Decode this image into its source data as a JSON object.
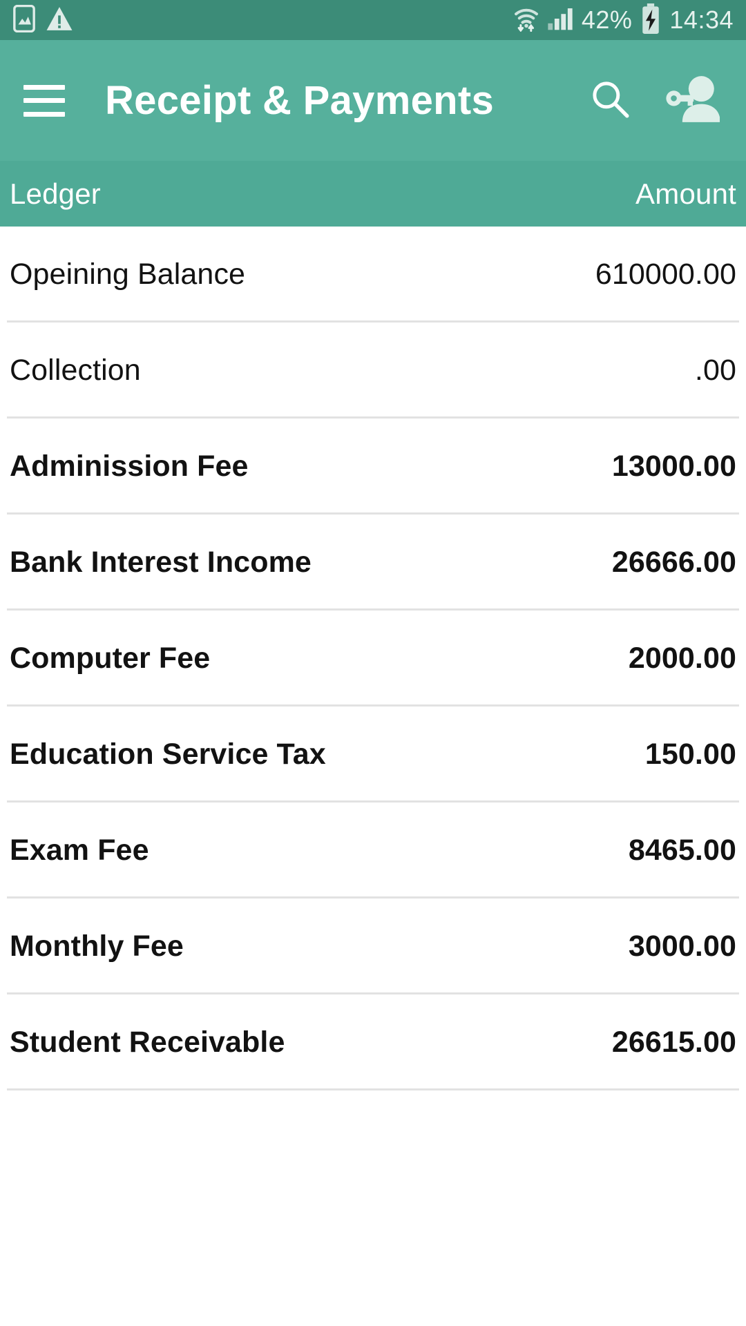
{
  "status_bar": {
    "icons_left": [
      "screenshot-icon",
      "warning-icon"
    ],
    "wifi_icon": "wifi-icon",
    "signal_icon": "cellular-signal-icon",
    "battery_percent": "42%",
    "battery_icon": "battery-charging-icon",
    "time": "14:34"
  },
  "app_bar": {
    "menu_icon": "hamburger-menu-icon",
    "title": "Receipt & Payments",
    "search_icon": "search-icon",
    "account_icon": "account-key-icon"
  },
  "table": {
    "headers": {
      "ledger": "Ledger",
      "amount": "Amount"
    },
    "rows": [
      {
        "ledger": "Opeining Balance",
        "amount": "610000.00",
        "bold": false
      },
      {
        "ledger": "Collection",
        "amount": ".00",
        "bold": false
      },
      {
        "ledger": "Adminission Fee",
        "amount": "13000.00",
        "bold": true
      },
      {
        "ledger": "Bank Interest Income",
        "amount": "26666.00",
        "bold": true
      },
      {
        "ledger": "Computer Fee",
        "amount": "2000.00",
        "bold": true
      },
      {
        "ledger": "Education Service Tax",
        "amount": "150.00",
        "bold": true
      },
      {
        "ledger": "Exam Fee",
        "amount": "8465.00",
        "bold": true
      },
      {
        "ledger": "Monthly Fee",
        "amount": "3000.00",
        "bold": true
      },
      {
        "ledger": "Student Receivable",
        "amount": "26615.00",
        "bold": true
      }
    ]
  },
  "colors": {
    "status_bar_bg": "#3c8c78",
    "app_bar_bg": "#56b09c",
    "table_head_bg": "#4faa96",
    "divider": "#e2e2e2",
    "text_primary": "#121212",
    "on_primary": "#ffffff"
  }
}
